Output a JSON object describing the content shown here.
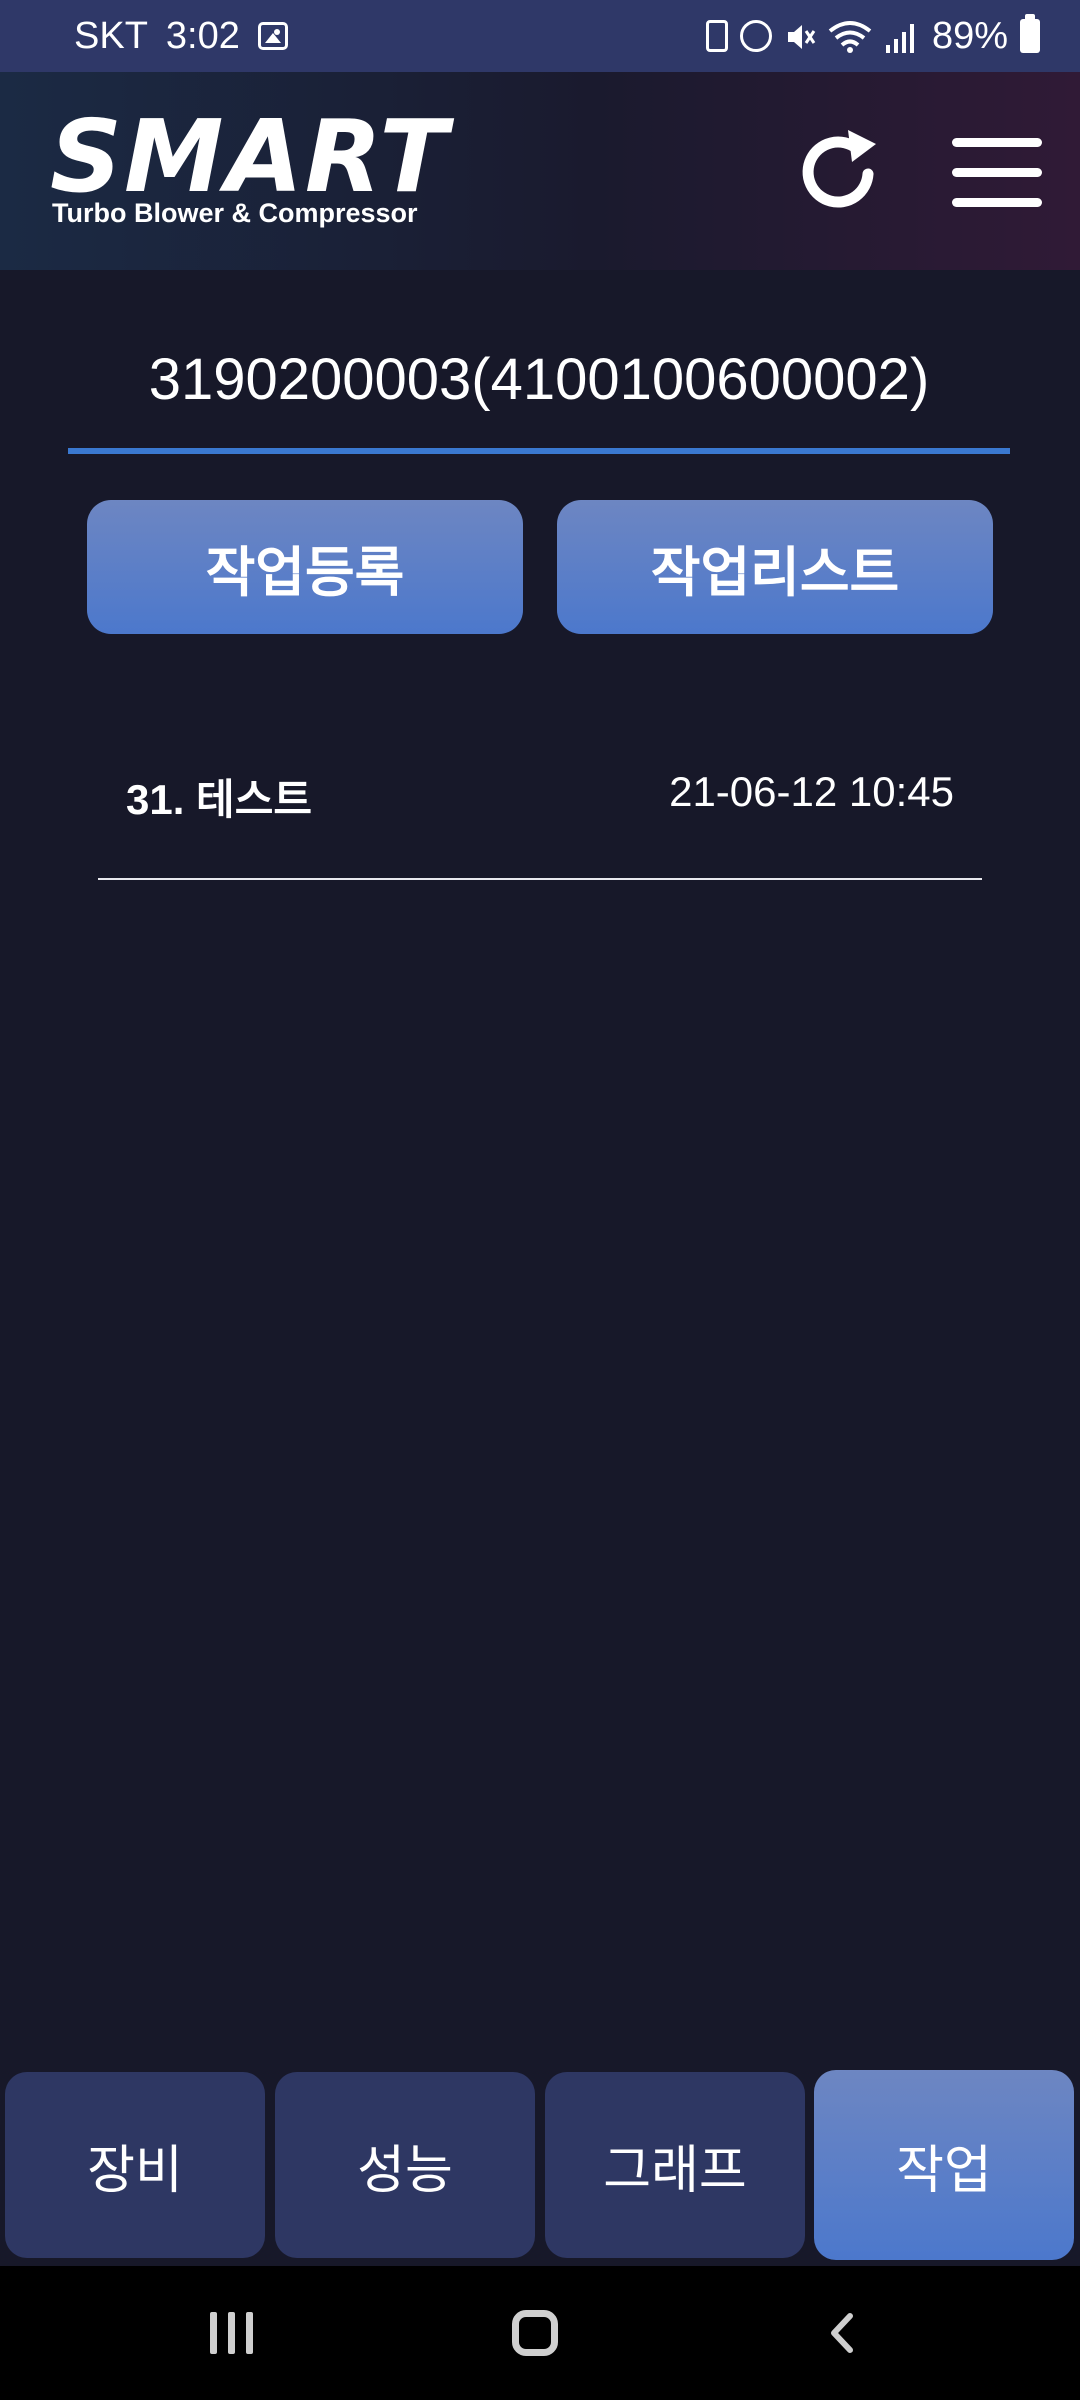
{
  "status_bar": {
    "carrier": "SKT",
    "time": "3:02",
    "battery": "89%"
  },
  "header": {
    "logo_text": "SMART",
    "logo_subtitle": "Turbo Blower & Compressor",
    "refresh_icon": "refresh-icon",
    "menu_icon": "hamburger-menu-icon"
  },
  "device": {
    "id": "3190200003(4100100600002)"
  },
  "actions": {
    "register_label": "작업등록",
    "list_label": "작업리스트"
  },
  "work_list": [
    {
      "title": "31. 테스트",
      "date": "21-06-12 10:45"
    }
  ],
  "tabs": [
    {
      "label": "장비",
      "active": false
    },
    {
      "label": "성능",
      "active": false
    },
    {
      "label": "그래프",
      "active": false
    },
    {
      "label": "작업",
      "active": true
    }
  ],
  "colors": {
    "background": "#171829",
    "accent": "#4c78cc",
    "tab_inactive": "#2e3763",
    "status_bar": "#2f3868"
  }
}
